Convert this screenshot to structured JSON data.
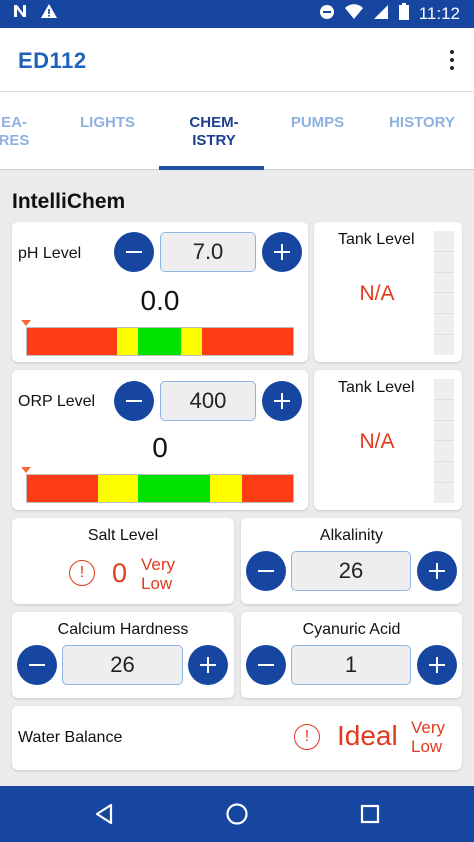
{
  "status_bar": {
    "left_icons": [
      "n-notification-icon",
      "warning-icon"
    ],
    "right_icons": [
      "dnd-icon",
      "wifi-icon",
      "signal-icon",
      "battery-icon"
    ],
    "time": "11:12"
  },
  "app_bar": {
    "title": "ED112",
    "menu_icon": "overflow-menu-icon"
  },
  "tabs": [
    {
      "label": "EA-\nRES",
      "active": false
    },
    {
      "label": "LIGHTS",
      "active": false
    },
    {
      "label": "CHEM-\nISTRY",
      "active": true
    },
    {
      "label": "PUMPS",
      "active": false
    },
    {
      "label": "HISTORY",
      "active": false
    }
  ],
  "section_title": "IntelliChem",
  "ph": {
    "label": "pH Level",
    "setpoint": "7.0",
    "reading": "0.0",
    "tank_label": "Tank Level",
    "tank_value": "N/A"
  },
  "orp": {
    "label": "ORP Level",
    "setpoint": "400",
    "reading": "0",
    "tank_label": "Tank Level",
    "tank_value": "N/A"
  },
  "salt": {
    "label": "Salt Level",
    "value": "0",
    "status": "Very\nLow"
  },
  "alkalinity": {
    "label": "Alkalinity",
    "value": "26"
  },
  "calcium": {
    "label": "Calcium Hardness",
    "value": "26"
  },
  "cyanuric": {
    "label": "Cyanuric Acid",
    "value": "1"
  },
  "water_balance": {
    "label": "Water Balance",
    "value": "Ideal",
    "status": "Very\nLow"
  },
  "colors": {
    "primary": "#1646a0",
    "title_blue": "#1f63bd",
    "alert_red": "#e03b1e",
    "scale_red": "#ff3b14",
    "scale_yellow": "#ffff00",
    "scale_green": "#00e100"
  }
}
